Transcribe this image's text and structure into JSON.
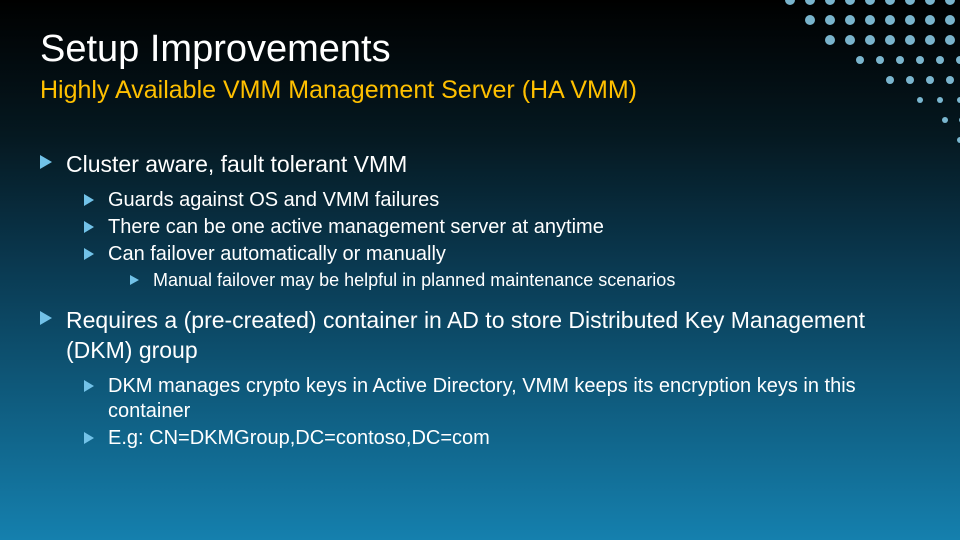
{
  "title": "Setup Improvements",
  "subtitle": "Highly Available VMM Management Server (HA VMM)",
  "bullets": [
    {
      "level": 1,
      "text": "Cluster aware, fault tolerant VMM",
      "gap": false
    },
    {
      "level": 2,
      "text": "Guards against OS and VMM failures",
      "gap": true
    },
    {
      "level": 2,
      "text": "There can be one active management server at anytime",
      "gap": false
    },
    {
      "level": 2,
      "text": "Can failover automatically or manually",
      "gap": false
    },
    {
      "level": 3,
      "text": "Manual failover may be helpful in planned maintenance scenarios",
      "gap": false
    },
    {
      "level": 1,
      "text": "Requires a (pre-created) container in AD to store Distributed Key Management (DKM) group",
      "gap": true
    },
    {
      "level": 2,
      "text": "DKM manages crypto keys in Active Directory, VMM keeps its encryption keys in this container",
      "gap": true
    },
    {
      "level": 2,
      "text": "E.g: CN=DKMGroup,DC=contoso,DC=com",
      "gap": false
    }
  ]
}
